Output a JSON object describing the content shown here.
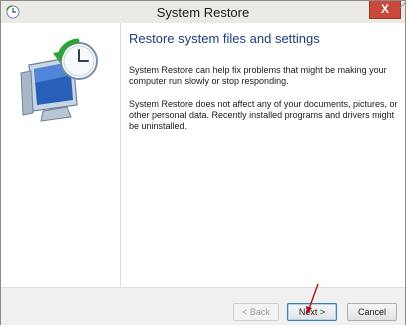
{
  "window": {
    "title": "System Restore",
    "close_symbol": "X",
    "close_color": "#c9493b"
  },
  "icons": {
    "app": "system-restore-icon",
    "hero": "computer-restore-clock-icon"
  },
  "content": {
    "heading": "Restore system files and settings",
    "paragraph1": "System Restore can help fix problems that might be making your computer run slowly or stop responding.",
    "paragraph2": "System Restore does not affect any of your documents, pictures, or other personal data. Recently installed programs and drivers might be uninstalled."
  },
  "buttons": {
    "back": "< Back",
    "next": "Next >",
    "cancel": "Cancel"
  },
  "annotation": {
    "arrow_color": "#b01010"
  }
}
